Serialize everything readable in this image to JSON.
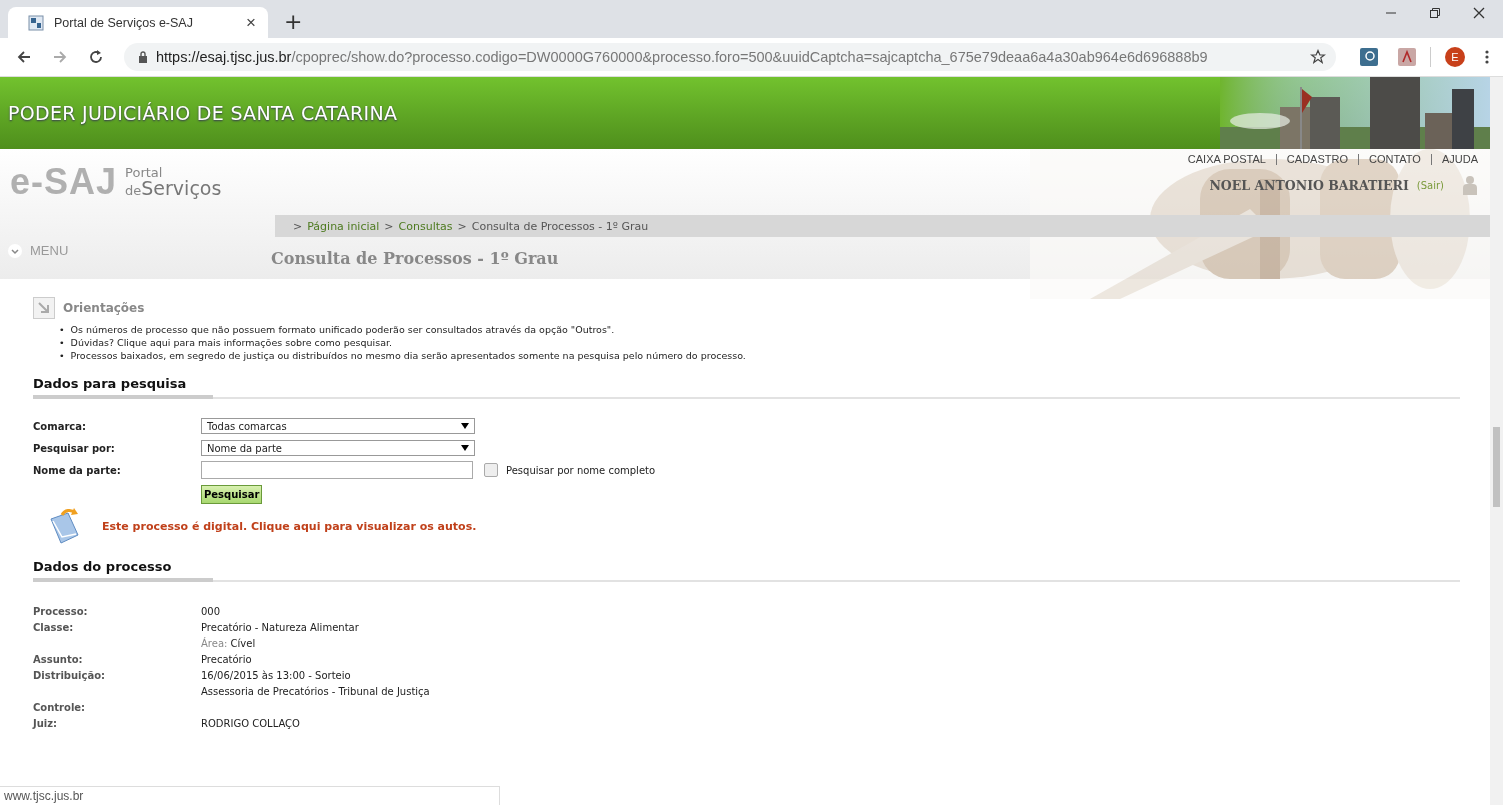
{
  "browser": {
    "tab_title": "Portal de Serviços e-SAJ",
    "tab_close": "×",
    "new_tab": "+",
    "url": {
      "host": "https://esaj.tjsc.jus.br",
      "path": "/cpoprec/show.do?processo.codigo=DW0000G760000&processo.foro=500&uuidCaptcha=sajcaptcha_675e79deaa6a4a30ab964e6d696888b9"
    },
    "profile_initial": "E"
  },
  "banner": {
    "title": "PODER JUDICIÁRIO DE SANTA CATARINA"
  },
  "logo": {
    "mark": "e-SAJ",
    "portal": "Portal",
    "de": "de",
    "servicos": "Serviços"
  },
  "top_links": [
    "CAIXA POSTAL",
    "CADASTRO",
    "CONTATO",
    "AJUDA"
  ],
  "user": {
    "name": "NOEL ANTONIO BARATIERI",
    "logout": "(Sair)"
  },
  "breadcrumb": [
    {
      "separator": ">",
      "text": "Página inicial",
      "link": true
    },
    {
      "separator": ">",
      "text": "Consultas",
      "link": true
    },
    {
      "separator": ">",
      "text": "Consulta de Processos - 1º Grau",
      "link": false
    }
  ],
  "menu": {
    "label": "MENU"
  },
  "page_title": "Consulta de Processos - 1º Grau",
  "guidance": {
    "title": "Orientações",
    "bullet": "•",
    "items": [
      "Os números de processo que não possuem formato unificado poderão ser consultados através da opção \"Outros\".",
      "Dúvidas? Clique aqui para mais informações sobre como pesquisar.",
      "Processos baixados, em segredo de justiça ou distribuídos no mesmo dia serão apresentados somente na pesquisa pelo número do processo."
    ]
  },
  "search": {
    "title": "Dados para pesquisa",
    "fields": [
      {
        "kind": "select",
        "label": "Comarca:",
        "value": "Todas comarcas"
      },
      {
        "kind": "select",
        "label": "Pesquisar por:",
        "value": "Nome da parte"
      },
      {
        "kind": "text",
        "label": "Nome da parte:",
        "checkbox_label": "Pesquisar por nome completo",
        "checked": false
      }
    ],
    "button": "Pesquisar"
  },
  "digital_notice": "Este processo é digital. Clique aqui para visualizar os autos.",
  "process": {
    "title": "Dados do processo",
    "rows": [
      {
        "label": "Processo:",
        "lines": [
          {
            "text": "000"
          }
        ]
      },
      {
        "label": "Classe:",
        "lines": [
          {
            "text": "Precatório - Natureza Alimentar"
          },
          {
            "caption": "Área:",
            "text": "Cível"
          }
        ]
      },
      {
        "label": "Assunto:",
        "lines": [
          {
            "text": "Precatório"
          }
        ]
      },
      {
        "label": "Distribuição:",
        "lines": [
          {
            "text": "16/06/2015 às 13:00 - Sorteio"
          },
          {
            "text": "Assessoria de Precatórios - Tribunal de Justiça"
          }
        ]
      },
      {
        "label": "Controle:",
        "lines": []
      },
      {
        "label": "Juiz:",
        "lines": [
          {
            "text": "RODRIGO COLLAÇO"
          }
        ]
      }
    ]
  },
  "status_bar": "www.tjsc.jus.br"
}
